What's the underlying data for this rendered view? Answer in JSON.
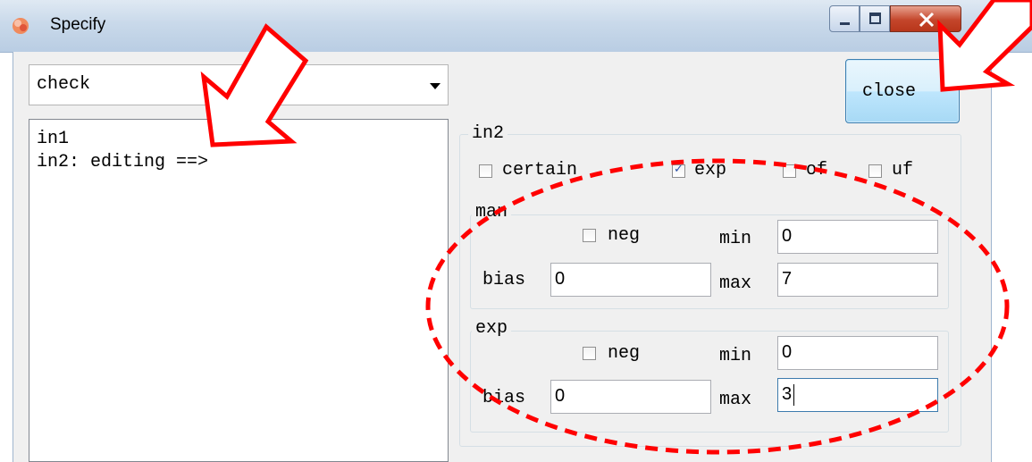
{
  "window": {
    "title": "Specify",
    "controls": {
      "minimize": "minimize",
      "maximize": "maximize",
      "close": "close"
    }
  },
  "combo": {
    "value": "check"
  },
  "listbox": {
    "lines": [
      "in1",
      "in2: editing ==>"
    ]
  },
  "close_button": {
    "label": "close"
  },
  "in2_group": {
    "label": "in2",
    "checkboxes": [
      {
        "label": "certain",
        "checked": false
      },
      {
        "label": "exp",
        "checked": true
      },
      {
        "label": "of",
        "checked": false
      },
      {
        "label": "uf",
        "checked": false
      }
    ]
  },
  "man_group": {
    "label": "man",
    "neg_label": "neg",
    "neg_checked": false,
    "min_label": "min",
    "min_value": "0",
    "bias_label": "bias",
    "bias_value": "0",
    "max_label": "max",
    "max_value": "7"
  },
  "exp_group": {
    "label": "exp",
    "neg_label": "neg",
    "neg_checked": false,
    "min_label": "min",
    "min_value": "0",
    "bias_label": "bias",
    "bias_value": "0",
    "max_label": "max",
    "max_value": "3"
  },
  "colors": {
    "annotation": "#ff0000",
    "accent": "#3c7fb1"
  }
}
